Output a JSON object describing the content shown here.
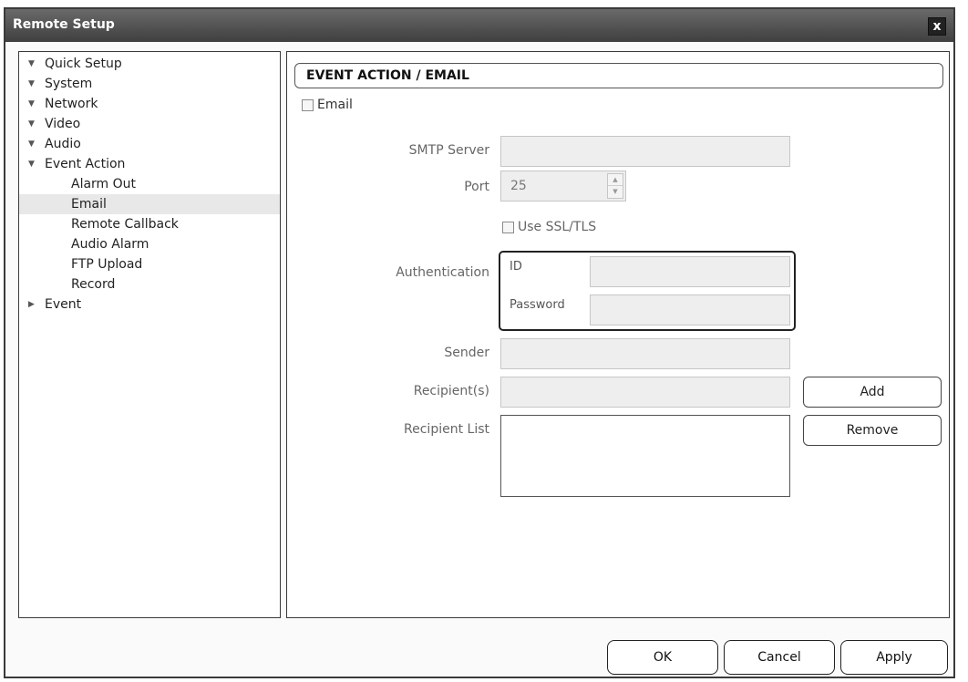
{
  "window": {
    "title": "Remote Setup",
    "close_label": "x"
  },
  "tree": {
    "items": [
      {
        "label": "Quick Setup"
      },
      {
        "label": "System"
      },
      {
        "label": "Network"
      },
      {
        "label": "Video"
      },
      {
        "label": "Audio"
      },
      {
        "label": "Event Action"
      },
      {
        "label": "Alarm Out"
      },
      {
        "label": "Email"
      },
      {
        "label": "Remote Callback"
      },
      {
        "label": "Audio Alarm"
      },
      {
        "label": "FTP Upload"
      },
      {
        "label": "Record"
      },
      {
        "label": "Event"
      }
    ],
    "selected": "Email"
  },
  "panel": {
    "header": "EVENT ACTION / EMAIL",
    "email_checkbox_label": "Email",
    "smtp_server_label": "SMTP Server",
    "smtp_server_value": "",
    "port_label": "Port",
    "port_value": "25",
    "ssl_label": "Use SSL/TLS",
    "authentication_label": "Authentication",
    "id_label": "ID",
    "id_value": "",
    "password_label": "Password",
    "password_value": "",
    "sender_label": "Sender",
    "sender_value": "",
    "recipients_label": "Recipient(s)",
    "recipients_value": "",
    "recipient_list_label": "Recipient List",
    "add_button": "Add",
    "remove_button": "Remove"
  },
  "footer": {
    "ok": "OK",
    "cancel": "Cancel",
    "apply": "Apply"
  }
}
